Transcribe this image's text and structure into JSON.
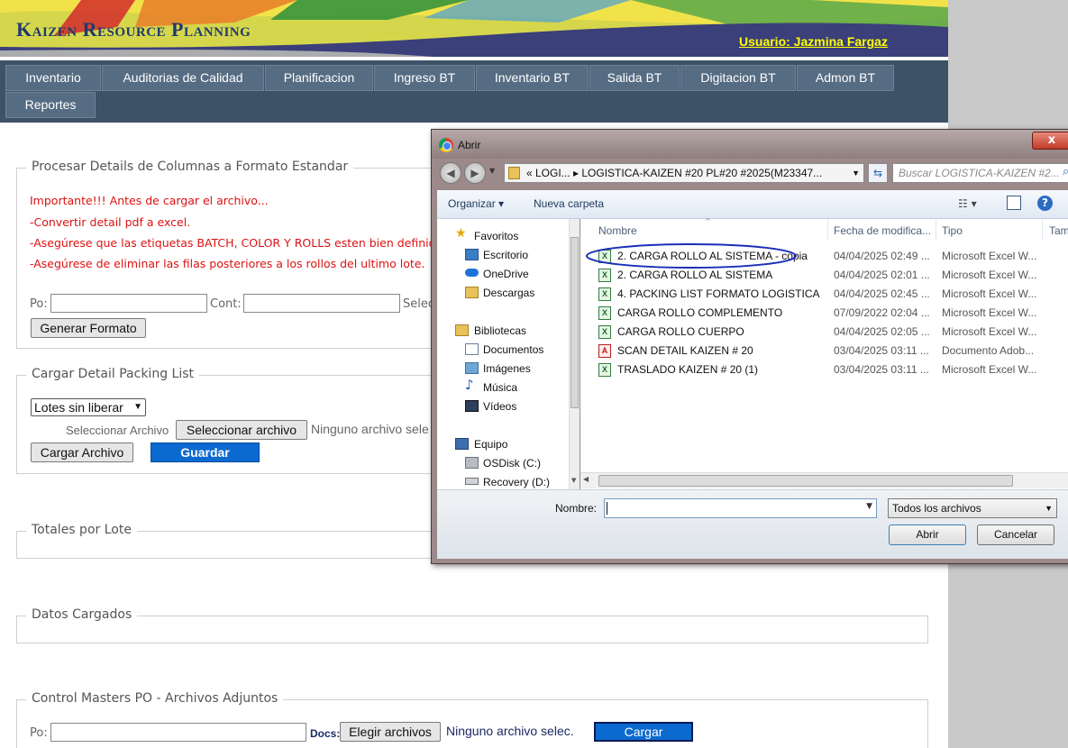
{
  "header": {
    "app_title": "Kaizen Resource Planning",
    "user_link": "Usuario: Jazmina Fargaz"
  },
  "nav": {
    "items": [
      "Inventario",
      "Auditorias de Calidad",
      "Planificacion",
      "Ingreso BT",
      "Inventario BT",
      "Salida BT",
      "Digitacion BT",
      "Admon BT",
      "Reportes"
    ]
  },
  "section_process": {
    "legend": "Procesar Details de Columnas a Formato Estandar",
    "notes": [
      "Importante!!! Antes de cargar el archivo...",
      "-Convertir detail pdf a excel.",
      "-Asegúrese que las etiquetas BATCH, COLOR Y ROLLS esten bien definid",
      "-Asegúrese de eliminar las filas posteriores a los rollos del ultimo lote."
    ],
    "po_label": "Po:",
    "cont_label": "Cont:",
    "partial_label": "Selec",
    "generate_button": "Generar Formato"
  },
  "section_upload": {
    "legend": "Cargar Detail Packing List",
    "select_value": "Lotes sin liberar",
    "file_label": "Seleccionar Archivo",
    "file_button": "Seleccionar archivo",
    "file_status": "Ninguno archivo sele",
    "upload_button": "Cargar Archivo",
    "save_button": "Guardar"
  },
  "section_totals": {
    "legend": "Totales por Lote"
  },
  "section_loaded": {
    "legend": "Datos Cargados"
  },
  "section_masters": {
    "legend": "Control Masters PO - Archivos Adjuntos",
    "po_label": "Po:",
    "docs_label": "Docs:",
    "choose_button": "Elegir archivos",
    "file_status": "Ninguno archivo selec.",
    "upload_button": "Cargar"
  },
  "dialog": {
    "title": "Abrir",
    "close": "x",
    "address": "«  LOGI...  ▸ LOGISTICA-KAIZEN #20 PL#20 #2025(M23347...",
    "search_placeholder": "Buscar LOGISTICA-KAIZEN #2...",
    "toolbar": {
      "organize": "Organizar ▾",
      "new_folder": "Nueva carpeta"
    },
    "nav_pane": {
      "favorites": "Favoritos",
      "favorites_items": [
        "Escritorio",
        "OneDrive",
        "Descargas"
      ],
      "libraries": "Bibliotecas",
      "libraries_items": [
        "Documentos",
        "Imágenes",
        "Música",
        "Vídeos"
      ],
      "computer": "Equipo",
      "computer_items": [
        "OSDisk (C:)",
        "Recovery (D:)"
      ]
    },
    "columns": [
      "Nombre",
      "Fecha de modifica...",
      "Tipo",
      "Tam"
    ],
    "files": [
      {
        "name": "2. CARGA ROLLO AL SISTEMA - copia",
        "date": "04/04/2025 02:49 ...",
        "type": "Microsoft Excel W...",
        "icon": "excel-icon"
      },
      {
        "name": "2. CARGA ROLLO AL SISTEMA",
        "date": "04/04/2025 02:01 ...",
        "type": "Microsoft Excel W...",
        "icon": "excel-icon"
      },
      {
        "name": "4. PACKING LIST FORMATO LOGISTICA",
        "date": "04/04/2025 02:45 ...",
        "type": "Microsoft Excel W...",
        "icon": "excel-icon"
      },
      {
        "name": "CARGA ROLLO COMPLEMENTO",
        "date": "07/09/2022 02:04 ...",
        "type": "Microsoft Excel W...",
        "icon": "excel-icon"
      },
      {
        "name": "CARGA ROLLO CUERPO",
        "date": "04/04/2025 02:05 ...",
        "type": "Microsoft Excel W...",
        "icon": "excel-icon"
      },
      {
        "name": "SCAN DETAIL KAIZEN # 20",
        "date": "03/04/2025 03:11 ...",
        "type": "Documento Adob...",
        "icon": "pdf-icon"
      },
      {
        "name": "TRASLADO KAIZEN # 20 (1)",
        "date": "03/04/2025 03:11 ...",
        "type": "Microsoft Excel W...",
        "icon": "excel-icon"
      }
    ],
    "filename_label": "Nombre:",
    "filename_value": "",
    "filter_value": "Todos los archivos",
    "open_button": "Abrir",
    "cancel_button": "Cancelar"
  }
}
